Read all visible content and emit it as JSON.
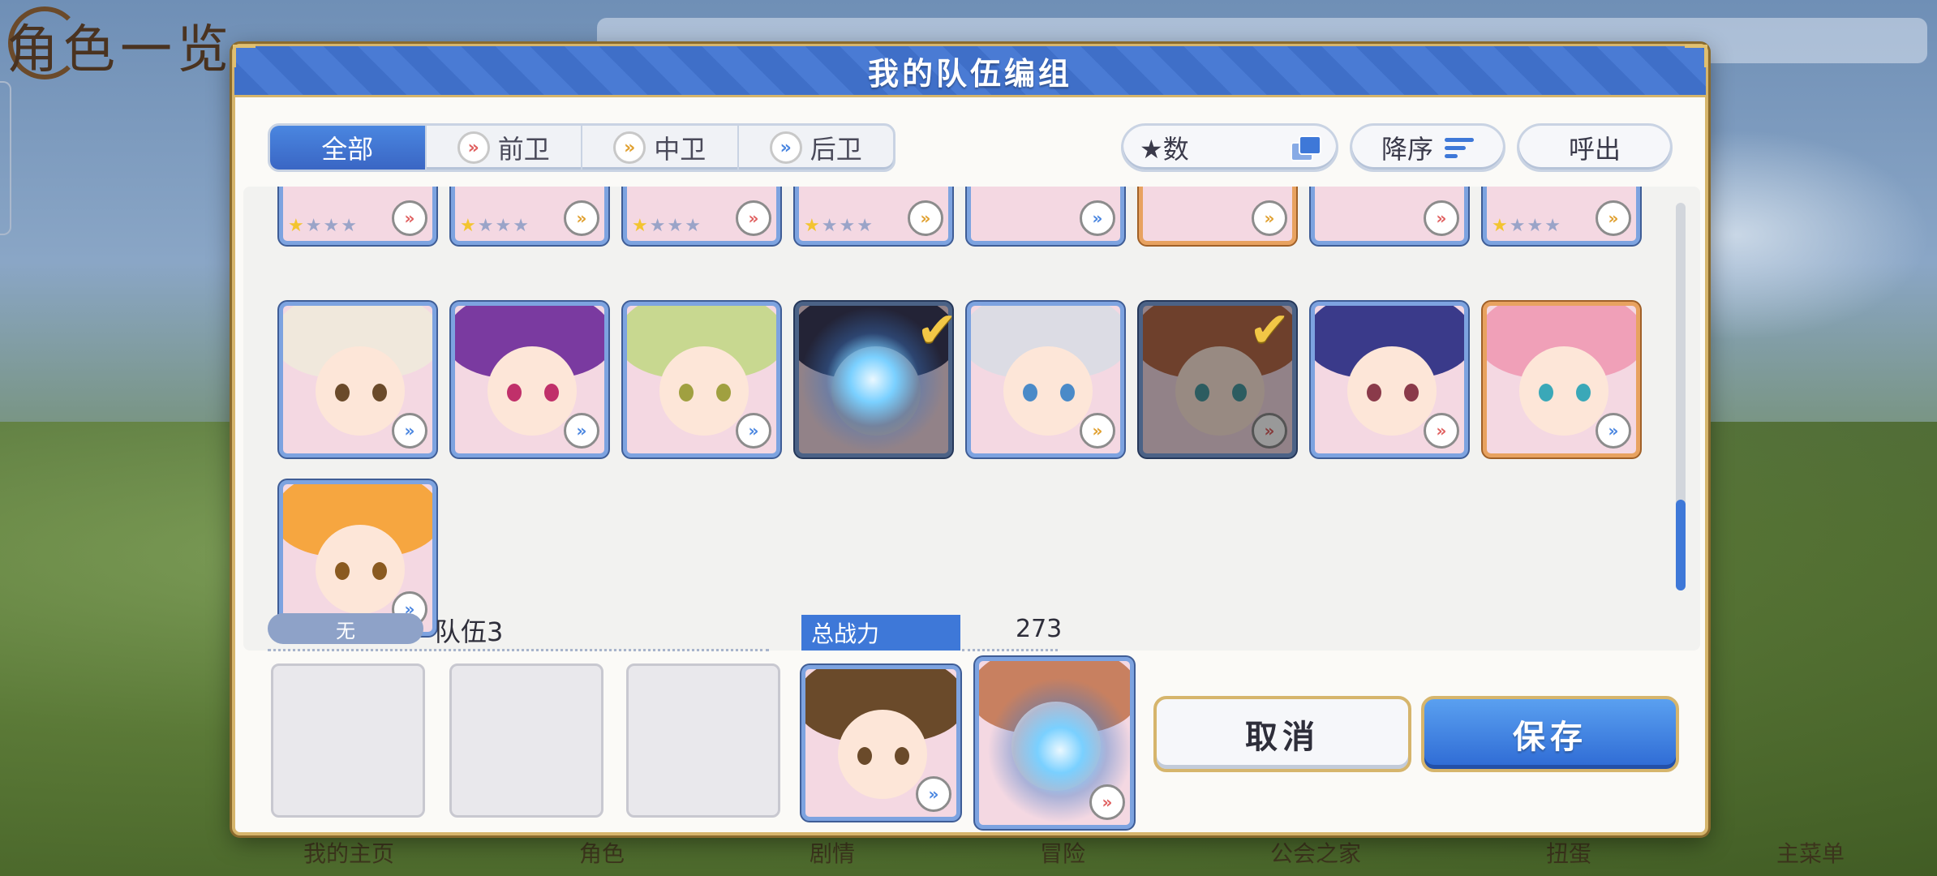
{
  "background": {
    "title": "角色一览",
    "bottom_nav": [
      "我的主页",
      "角色",
      "剧情",
      "冒险",
      "公会之家",
      "扭蛋",
      "主菜单"
    ]
  },
  "modal": {
    "title": "我的队伍编组",
    "filter_tabs": [
      {
        "label": "全部",
        "icon": null,
        "active": true
      },
      {
        "label": "前卫",
        "icon": "front-role-icon",
        "active": false
      },
      {
        "label": "中卫",
        "icon": "mid-role-icon",
        "active": false
      },
      {
        "label": "后卫",
        "icon": "back-role-icon",
        "active": false
      }
    ],
    "sort_stars_label": "★数",
    "sort_order_label": "降序",
    "call_label": "呼出"
  },
  "team": {
    "badge": "无",
    "name": "队伍3",
    "power_label": "总战力",
    "power_value": "273"
  },
  "buttons": {
    "cancel": "取消",
    "save": "保存"
  },
  "colors": {
    "accent_blue": "#3e78d8",
    "gold_frame": "#d6b56c",
    "star_on": "#f3c430",
    "role_front": "#e06060",
    "role_mid": "#e0a030",
    "role_back": "#4a86e0"
  }
}
